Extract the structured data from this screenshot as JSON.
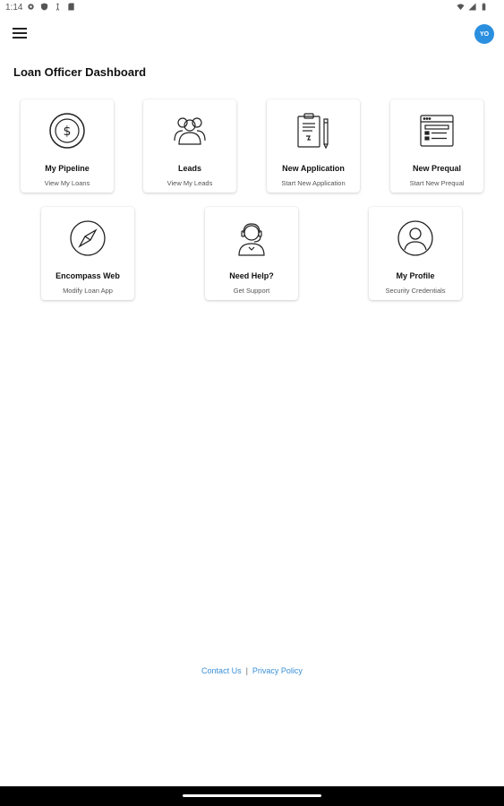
{
  "status_bar": {
    "time": "1:14"
  },
  "header": {
    "avatar_initials": "YO"
  },
  "page": {
    "title": "Loan Officer Dashboard"
  },
  "tiles": [
    {
      "title": "My Pipeline",
      "subtitle": "View My Loans",
      "icon": "dollar-circle-icon"
    },
    {
      "title": "Leads",
      "subtitle": "View My Leads",
      "icon": "people-group-icon"
    },
    {
      "title": "New Application",
      "subtitle": "Start New Application",
      "icon": "clipboard-pencil-icon"
    },
    {
      "title": "New Prequal",
      "subtitle": "Start New Prequal",
      "icon": "form-window-icon"
    },
    {
      "title": "Encompass Web",
      "subtitle": "Modify Loan App",
      "icon": "compass-icon"
    },
    {
      "title": "Need Help?",
      "subtitle": "Get Support",
      "icon": "support-agent-icon"
    },
    {
      "title": "My Profile",
      "subtitle": "Security Credentials",
      "icon": "profile-circle-icon"
    }
  ],
  "footer": {
    "contact_label": "Contact Us",
    "separator": "|",
    "privacy_label": "Privacy Policy"
  },
  "colors": {
    "accent": "#2b8fe0",
    "link": "#3a8fd6"
  }
}
